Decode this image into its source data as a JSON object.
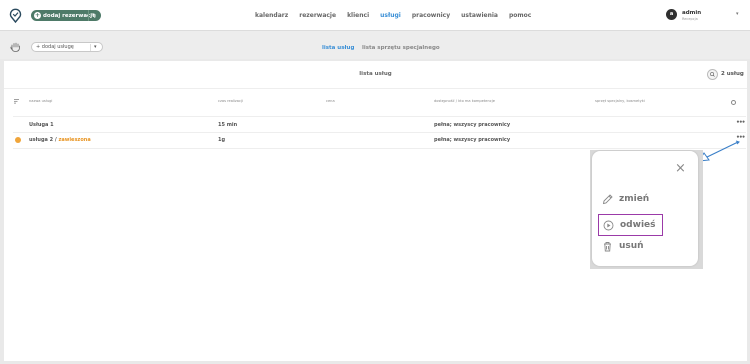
{
  "topbar": {
    "add_reservation": "dodaj rezerwację",
    "nav": [
      "kalendarz",
      "rezerwacje",
      "klienci",
      "usługi",
      "pracownicy",
      "ustawienia",
      "pomoc"
    ],
    "active_nav": "usługi",
    "user": {
      "avatar_letter": "a",
      "name": "admin",
      "role": "Recepcja"
    }
  },
  "subbar": {
    "add_service": "dodaj usługę",
    "tabs": [
      "lista usług",
      "lista sprzętu specjalnego"
    ],
    "active_tab": "lista usług"
  },
  "panel": {
    "title": "lista usług",
    "count": "2 usług",
    "columns": [
      "nazwa usługi",
      "czas realizacji",
      "cena",
      "dostępność / kto ma kompetencje",
      "sprzęt specjalny, kosmetyki"
    ],
    "rows": [
      {
        "name": "Usługa 1",
        "time": "15 min",
        "price": "",
        "availability": "pełna; wszyscy pracownicy",
        "equipment": ""
      },
      {
        "name": "usługa 2 / ",
        "status": "zawieszona",
        "time": "1g",
        "price": "",
        "availability": "pełna; wszyscy pracownicy",
        "equipment": ""
      }
    ]
  },
  "context_menu": {
    "items": [
      {
        "label": "zmień",
        "icon": "pencil-icon"
      },
      {
        "label": "odwieś",
        "icon": "play-circle-icon"
      },
      {
        "label": "usuń",
        "icon": "trash-icon"
      }
    ],
    "close": "×"
  },
  "colors": {
    "accent_green": "#4e7a68",
    "active_blue": "#3a8fd6",
    "suspended_orange": "#e8931f",
    "highlight_purple": "#9b3aa8"
  }
}
